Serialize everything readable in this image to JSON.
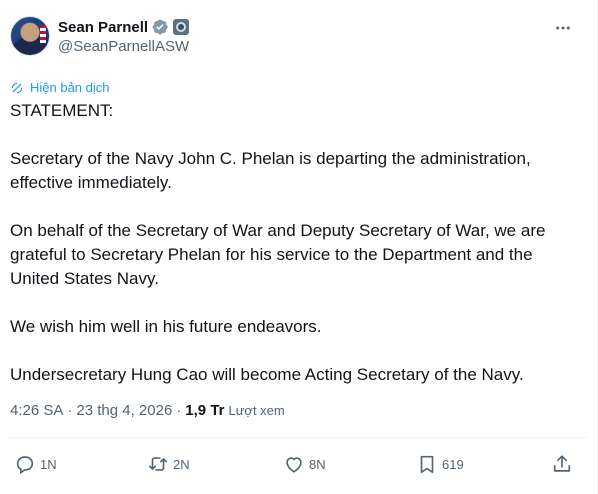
{
  "author": {
    "display_name": "Sean Parnell",
    "handle": "@SeanParnellASW"
  },
  "translate_label": "Hiện bản dịch",
  "body": {
    "paragraphs": [
      "STATEMENT:",
      "Secretary of the Navy John C. Phelan is departing the administration,\neffective immediately.",
      "On behalf of the Secretary of War and Deputy Secretary of War, we are\ngrateful to Secretary Phelan for his service to the Department and the\nUnited States Navy.",
      "We wish him well in his future endeavors.",
      "Undersecretary Hung Cao will become Acting Secretary of the Navy."
    ]
  },
  "meta": {
    "time": "4:26 SA",
    "separator": "·",
    "date": "23 thg 4, 2026",
    "views_count": "1,9 Tr",
    "views_label": "Lượt xem"
  },
  "actions": {
    "reply_count": "1N",
    "retweet_count": "2N",
    "like_count": "8N",
    "bookmark_count": "619"
  },
  "colors": {
    "accent": "#1d9bf0",
    "muted": "#536471",
    "text": "#0f1419"
  },
  "icons": {
    "verified": "verified-badge-icon",
    "affiliation": "affiliation-badge-icon",
    "more": "more-options-icon",
    "translate": "translate-icon",
    "reply": "reply-icon",
    "retweet": "retweet-icon",
    "like": "heart-icon",
    "bookmark": "bookmark-icon",
    "share": "share-icon"
  }
}
